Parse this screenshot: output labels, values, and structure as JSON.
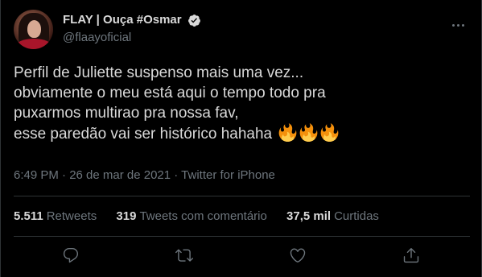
{
  "header": {
    "display_name": "FLAY | Ouça #Osmar",
    "handle": "@flaayoficial"
  },
  "tweet": {
    "lines": [
      "Perfil de Juliette suspenso mais uma vez...",
      "obviamente o meu está aqui o tempo todo pra",
      "puxarmos multirao pra nossa fav,",
      "esse paredão vai ser histórico hahaha"
    ],
    "emoji": [
      "🔥",
      "🔥",
      "🔥"
    ]
  },
  "meta": {
    "text": "6:49 PM · 26 de mar de 2021 · Twitter for iPhone"
  },
  "stats": {
    "retweets_count": "5.511",
    "retweets_label": "Retweets",
    "quotes_count": "319",
    "quotes_label": "Tweets com comentário",
    "likes_count": "37,5 mil",
    "likes_label": "Curtidas"
  },
  "actions": {
    "reply": "reply-icon",
    "retweet": "retweet-icon",
    "like": "heart-icon",
    "share": "share-icon"
  },
  "colors": {
    "background": "#000000",
    "text_primary": "#d9d9d9",
    "text_secondary": "#6e767d",
    "divider": "#2f3336",
    "verified": "#d9d9d9",
    "fire": "#f4900c"
  }
}
